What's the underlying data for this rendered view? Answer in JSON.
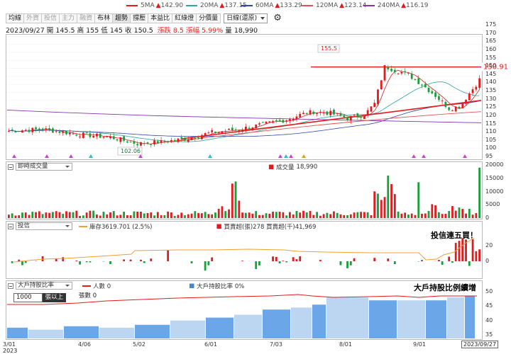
{
  "legend": [
    {
      "label": "5MA",
      "value": "142.90",
      "color": "#e31a1c"
    },
    {
      "label": "20MA",
      "value": "137.15",
      "color": "#2ca6a0"
    },
    {
      "label": "60MA",
      "value": "133.29",
      "color": "#3344aa"
    },
    {
      "label": "120MA",
      "value": "123.14",
      "color": "#e35050"
    },
    {
      "label": "240MA",
      "value": "116.19",
      "color": "#8833aa"
    }
  ],
  "toolbar": {
    "buttons": [
      "均線",
      "外資",
      "投信",
      "主力",
      "融資",
      "布林",
      "趨勢",
      "撐壓",
      "本益比",
      "紅綠燈",
      "分價量"
    ],
    "dim_indices": [
      1,
      2,
      3,
      4
    ],
    "active_index": 6,
    "period_select": "日線(還原)"
  },
  "quote": {
    "date": "2023/09/27",
    "open_label": "開",
    "open": "145.5",
    "high_label": "高",
    "high": "155",
    "low_label": "低",
    "low": "145",
    "close_label": "收",
    "close": "150.5",
    "change_label": "漲跌",
    "change": "8.5",
    "pct_label": "漲幅",
    "pct": "5.99%",
    "vol_label": "量",
    "volume": "18,990"
  },
  "price_panel": {
    "y_ticks": [
      "175",
      "170",
      "165",
      "160",
      "155",
      "150",
      "145",
      "140",
      "135",
      "130",
      "125",
      "120",
      "115",
      "110",
      "105",
      "100",
      "95"
    ],
    "high_marker": "155.5",
    "low_marker": "102.06",
    "last_price": "150.91"
  },
  "volume_panel": {
    "select": "即時成交量",
    "label": "成交量",
    "value": "18,990",
    "y_ticks": [
      "20000",
      "15000",
      "10000",
      "5000",
      "0"
    ]
  },
  "inst_panel": {
    "select": "投信",
    "holding": "庫存3619.701 (2.5%)",
    "buysell": "買賣超(張)278 買賣超(千)41,969",
    "note": "投信連五買！",
    "y_ticks": [
      "20",
      "0"
    ]
  },
  "holder_panel": {
    "select": "大戶持股比率",
    "threshold_select": "1000",
    "threshold_suffix": "張以上",
    "people_label": "人數 0",
    "shares_label": "張數 0",
    "ratio_label": "大戶持股比率 0%",
    "note": "大戶持股比例續增",
    "y_ticks": [
      "50",
      "45",
      "40",
      "35"
    ]
  },
  "x_axis": {
    "labels": [
      "3/01",
      "4/06",
      "5/02",
      "6/01",
      "7/03",
      "8/01",
      "9/01"
    ],
    "year": "2023",
    "current": "2023/09/27"
  },
  "colors": {
    "up": "#e31a1c",
    "down": "#1a9e3a",
    "blue_bar": "#6aa6e8",
    "light_bar": "#bcd6f2"
  }
}
